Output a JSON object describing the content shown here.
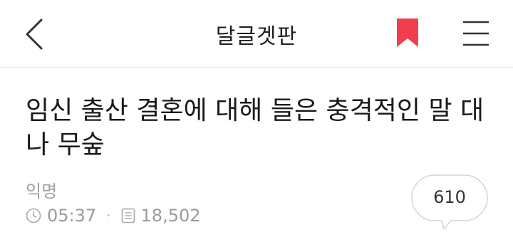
{
  "header": {
    "title": "달글겟판",
    "back_icon": "chevron-left-icon",
    "bookmark_icon": "bookmark-icon",
    "menu_icon": "hamburger-menu-icon",
    "bookmark_color": "#f03e4f"
  },
  "post": {
    "title": "임신 출산 결혼에 대해 들은 충격적인 말 대나 무숲",
    "author": "익명",
    "time": "05:37",
    "views": "18,502",
    "time_icon": "clock-icon",
    "views_icon": "document-icon"
  },
  "comments": {
    "count": "610",
    "icon": "speech-bubble-icon"
  }
}
